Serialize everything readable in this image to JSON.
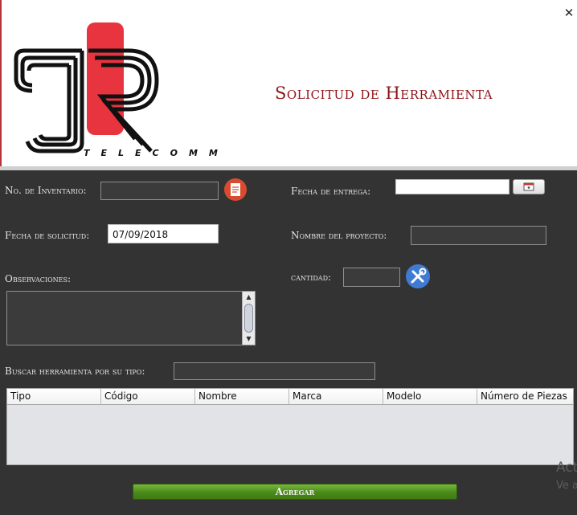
{
  "window": {
    "close_glyph": "✕"
  },
  "brand": {
    "logo_tagline": "TELECOMM",
    "icon": "jr-logo"
  },
  "header": {
    "title": "Solicitud de Herramienta"
  },
  "form": {
    "inventario_label": "No. de Inventario:",
    "inventario_value": "",
    "inventario_icon": "document-icon",
    "fecha_entrega_label": "Fecha de entrega:",
    "fecha_entrega_value": "",
    "calendar_icon": "calendar-icon",
    "fecha_solicitud_label": "Fecha de solicitud:",
    "fecha_solicitud_value": "07/09/2018",
    "proyecto_label": "Nombre del proyecto:",
    "proyecto_value": "",
    "observaciones_label": "Observaciones:",
    "observaciones_value": "",
    "cantidad_label": "cantidad:",
    "cantidad_value": "",
    "tools_icon": "tools-icon",
    "buscar_label": "Buscar herramienta por su tipo:",
    "buscar_value": ""
  },
  "table": {
    "columns": [
      "Tipo",
      "Código",
      "Nombre",
      "Marca",
      "Modelo",
      "Número de Piezas"
    ],
    "rows": []
  },
  "actions": {
    "agregar_label": "Agregar"
  },
  "watermark": {
    "line1": "Act",
    "line2": "Ve a"
  },
  "colors": {
    "title": "#8e1418",
    "panel": "#333333",
    "button": "#4a8a1a",
    "logo_red": "#e8343f"
  }
}
